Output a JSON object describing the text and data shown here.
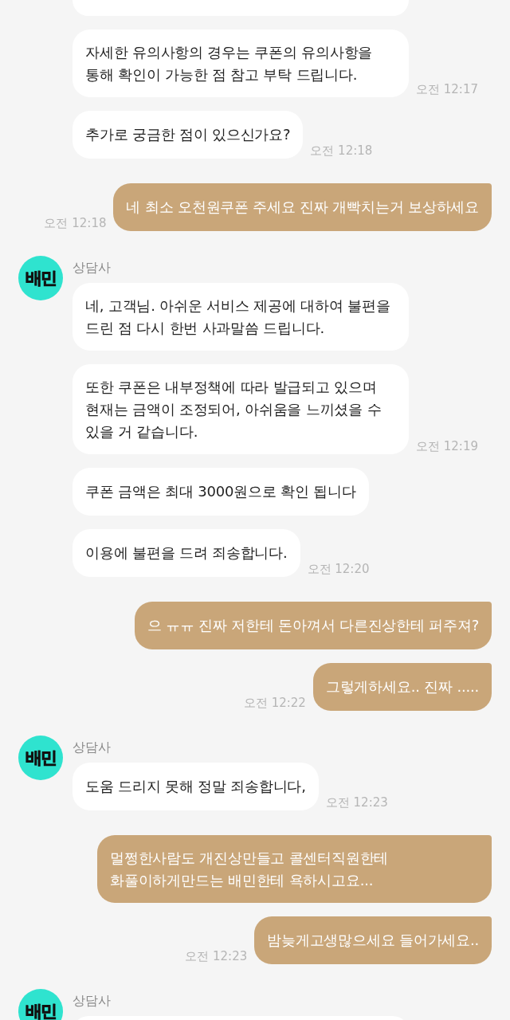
{
  "conversation": {
    "groups": [
      {
        "kind": "received",
        "messages": [
          {
            "kind": "clipped"
          },
          {
            "kind": "text",
            "text": "자세한 유의사항의 경우는 쿠폰의 유의사항을\n통해 확인이 가능한 점 참고 부탁 드립니다.",
            "time": "오전 12:17"
          },
          {
            "kind": "text",
            "text": "추가로 궁금한 점이 있으신가요?",
            "time": "오전 12:18"
          }
        ]
      },
      {
        "kind": "sent",
        "messages": [
          {
            "kind": "text",
            "text": "네 최소 오천원쿠폰 주세요 진짜 개빡치는거 보상하세요",
            "time": "오전 12:18"
          }
        ]
      },
      {
        "kind": "received",
        "avatar": "배민",
        "name": "상담사",
        "messages": [
          {
            "kind": "text",
            "text": "네, 고객님. 아쉬운 서비스 제공에 대하여 불편을\n드린 점 다시 한번 사과말씀 드립니다."
          },
          {
            "kind": "text",
            "text": "또한 쿠폰은 내부정책에 따라 발급되고 있으며\n현재는 금액이 조정되어, 아쉬움을 느끼셨을 수\n있을 거 같습니다.",
            "time": "오전 12:19"
          },
          {
            "kind": "text",
            "text": "쿠폰 금액은 최대 3000원으로 확인 됩니다"
          },
          {
            "kind": "text",
            "text": "이용에 불편을 드려 죄송합니다.",
            "time": "오전 12:20"
          }
        ]
      },
      {
        "kind": "sent",
        "messages": [
          {
            "kind": "text",
            "text": "으 ㅠㅠ 진짜 저한테 돈아껴서 다른진상한테 퍼주져?"
          },
          {
            "kind": "text",
            "text": "그렇게하세요.. 진짜 .....",
            "time": "오전 12:22"
          }
        ]
      },
      {
        "kind": "received",
        "avatar": "배민",
        "name": "상담사",
        "messages": [
          {
            "kind": "text",
            "text": "도움 드리지 못해 정말 죄송합니다,",
            "time": "오전 12:23"
          }
        ]
      },
      {
        "kind": "sent",
        "messages": [
          {
            "kind": "text",
            "text": "멀쩡한사람도 개진상만들고 콜센터직원한테\n화풀이하게만드는 배민한테 욕하시고요..."
          },
          {
            "kind": "text",
            "text": "밤늦게고생많으세요 들어가세요..",
            "time": "오전 12:23"
          }
        ]
      },
      {
        "kind": "received",
        "avatar": "배민",
        "name": "상담사",
        "messages": [
          {
            "kind": "clipped"
          }
        ]
      }
    ]
  }
}
